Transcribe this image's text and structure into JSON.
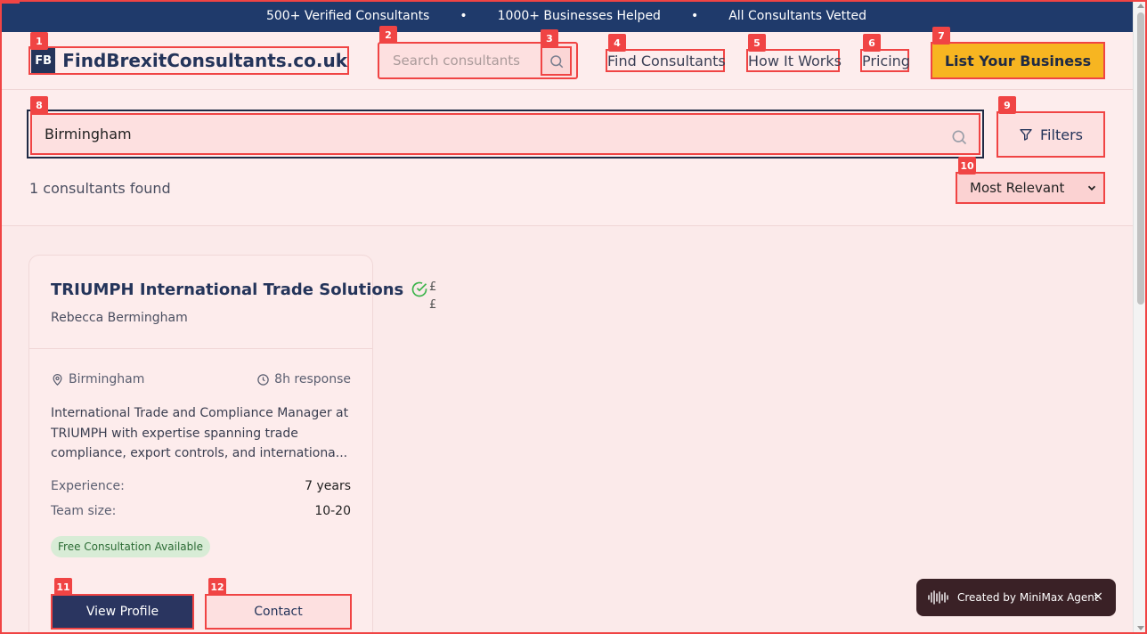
{
  "banner": {
    "items": [
      "500+ Verified Consultants",
      "1000+ Businesses Helped",
      "All Consultants Vetted"
    ],
    "separator": "•"
  },
  "header": {
    "logo_mark": "FB",
    "logo_text": "FindBrexitConsultants.co.uk",
    "search_placeholder": "Search consultants",
    "nav": {
      "find": "Find Consultants",
      "how": "How It Works",
      "pricing": "Pricing"
    },
    "cta": "List Your Business"
  },
  "search": {
    "value": "Birmingham",
    "filters_label": "Filters",
    "results_count": "1 consultants found",
    "sort_selected": "Most Relevant"
  },
  "card": {
    "title": "TRIUMPH International Trade Solutions",
    "price_symbols": [
      "£",
      "£"
    ],
    "contact_name": "Rebecca Bermingham",
    "location": "Birmingham",
    "response": "8h response",
    "description": "International Trade and Compliance Manager at TRIUMPH with expertise spanning trade compliance, export controls, and internationa...",
    "experience_label": "Experience:",
    "experience_value": "7 years",
    "team_label": "Team size:",
    "team_value": "10-20",
    "badge": "Free Consultation Available",
    "view_label": "View Profile",
    "contact_label": "Contact"
  },
  "toast": {
    "text": "Created by MiniMax Agent",
    "close": "×"
  },
  "markers": [
    "1",
    "2",
    "3",
    "4",
    "5",
    "6",
    "7",
    "8",
    "9",
    "10",
    "11",
    "12"
  ],
  "colors": {
    "banner_bg": "#1f3a6b",
    "brand_navy": "#24345a",
    "cta_yellow": "#f7b521",
    "marker_red": "#f04444",
    "page_bg": "#fbeaea",
    "badge_green": "#2b6b34",
    "verified_green": "#3cb44b"
  }
}
